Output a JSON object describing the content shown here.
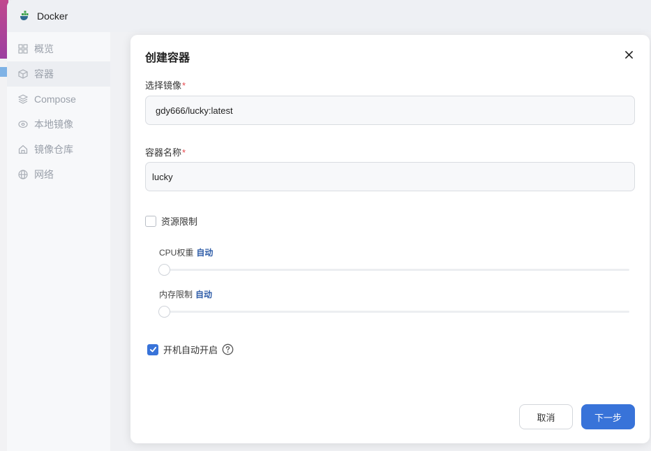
{
  "window": {
    "title": "Docker",
    "logo_icon": "docker-whale-icon"
  },
  "sidebar": {
    "items": [
      {
        "label": "概览",
        "icon": "grid-icon",
        "active": false
      },
      {
        "label": "容器",
        "icon": "cube-icon",
        "active": true
      },
      {
        "label": "Compose",
        "icon": "layers-icon",
        "active": false
      },
      {
        "label": "本地镜像",
        "icon": "disk-icon",
        "active": false
      },
      {
        "label": "镜像仓库",
        "icon": "home-icon",
        "active": false
      },
      {
        "label": "网络",
        "icon": "globe-icon",
        "active": false
      }
    ]
  },
  "dialog": {
    "title": "创建容器",
    "image_field": {
      "label": "选择镜像",
      "required_mark": "*",
      "value": "gdy666/lucky:latest"
    },
    "name_field": {
      "label": "容器名称",
      "required_mark": "*",
      "value": "lucky"
    },
    "resource_limit": {
      "label": "资源限制",
      "checked": false
    },
    "cpu_weight": {
      "label": "CPU权重",
      "value_text": "自动",
      "level": 0
    },
    "memory_limit": {
      "label": "内存限制",
      "value_text": "自动",
      "level": 0
    },
    "autostart": {
      "label": "开机自动开启",
      "checked": true
    },
    "buttons": {
      "cancel": "取消",
      "next": "下一步"
    }
  },
  "colors": {
    "accent": "#3873d9",
    "required": "#e5484d",
    "auto_text": "#2f5da8"
  }
}
